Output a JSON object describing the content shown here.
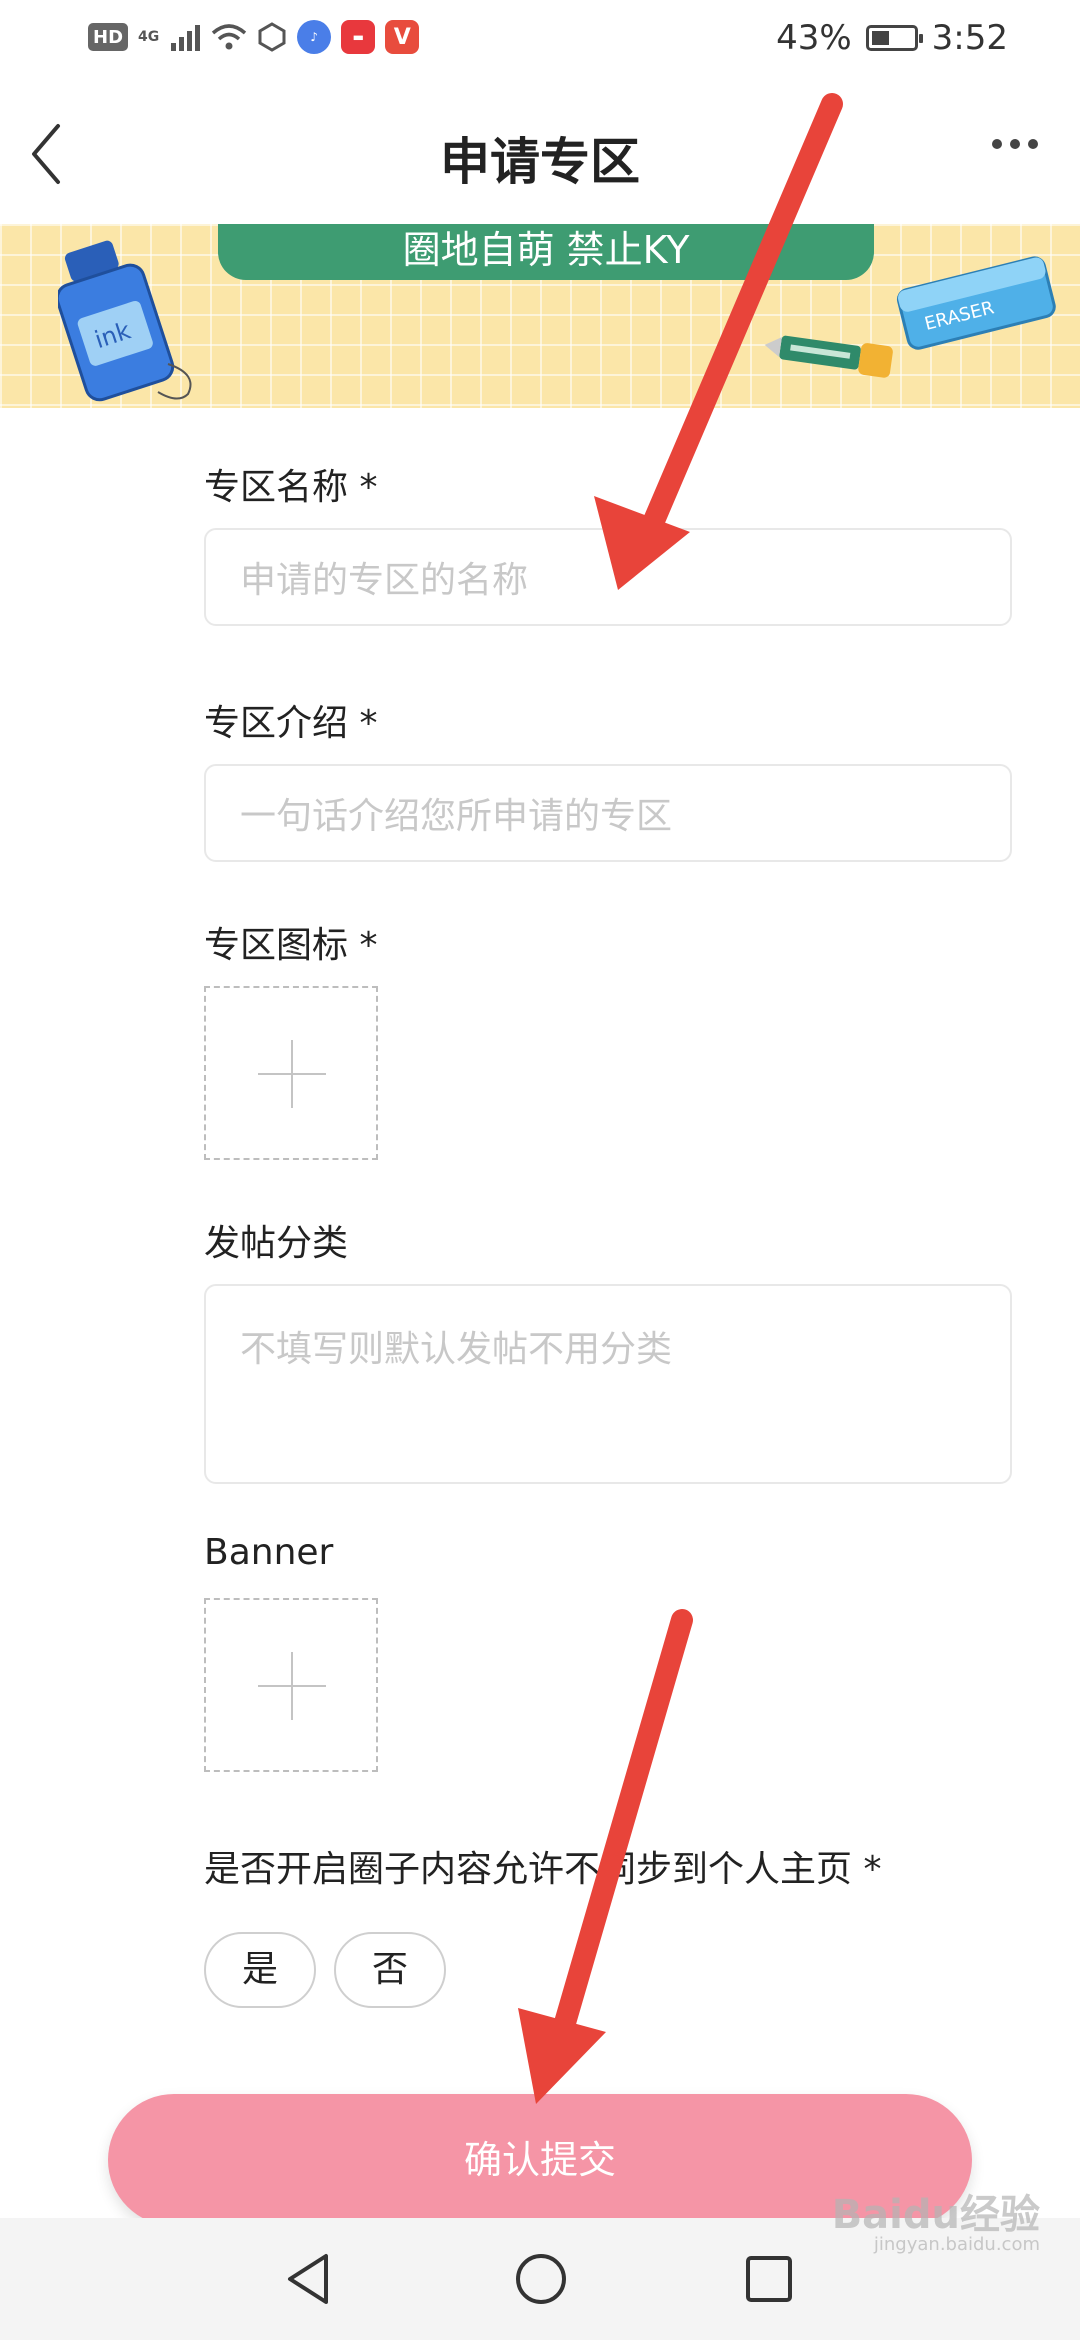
{
  "status_bar": {
    "left_icons": [
      "HD",
      "4G",
      "signal-icon",
      "wifi-icon",
      "app-icon",
      "music-icon",
      "huawei-icon",
      "v-icon"
    ],
    "hd": "HD",
    "network": "4G",
    "battery_text": "43%",
    "battery_level": 0.43,
    "time": "3:52"
  },
  "header": {
    "title": "申请专区",
    "more": "•••"
  },
  "banner": {
    "slogan": "圈地自萌 禁止KY",
    "ink_label": "ink",
    "eraser_label": "ERASER"
  },
  "form": {
    "name": {
      "label": "专区名称 *",
      "placeholder": "申请的专区的名称"
    },
    "intro": {
      "label": "专区介绍 *",
      "placeholder": "一句话介绍您所申请的专区"
    },
    "icon": {
      "label": "专区图标 *"
    },
    "category": {
      "label": "发帖分类",
      "placeholder": "不填写则默认发帖不用分类"
    },
    "banner": {
      "label": "Banner"
    },
    "sync": {
      "label": "是否开启圈子内容允许不同步到个人主页 *",
      "yes": "是",
      "no": "否"
    },
    "submit": "确认提交"
  },
  "watermark": {
    "text": "Baidu经验",
    "sub": "jingyan.baidu.com"
  },
  "colors": {
    "accent": "#f595a6",
    "banner_green": "#3e9c72",
    "banner_bg": "#fbe6a8",
    "arrow": "#e8443a"
  }
}
